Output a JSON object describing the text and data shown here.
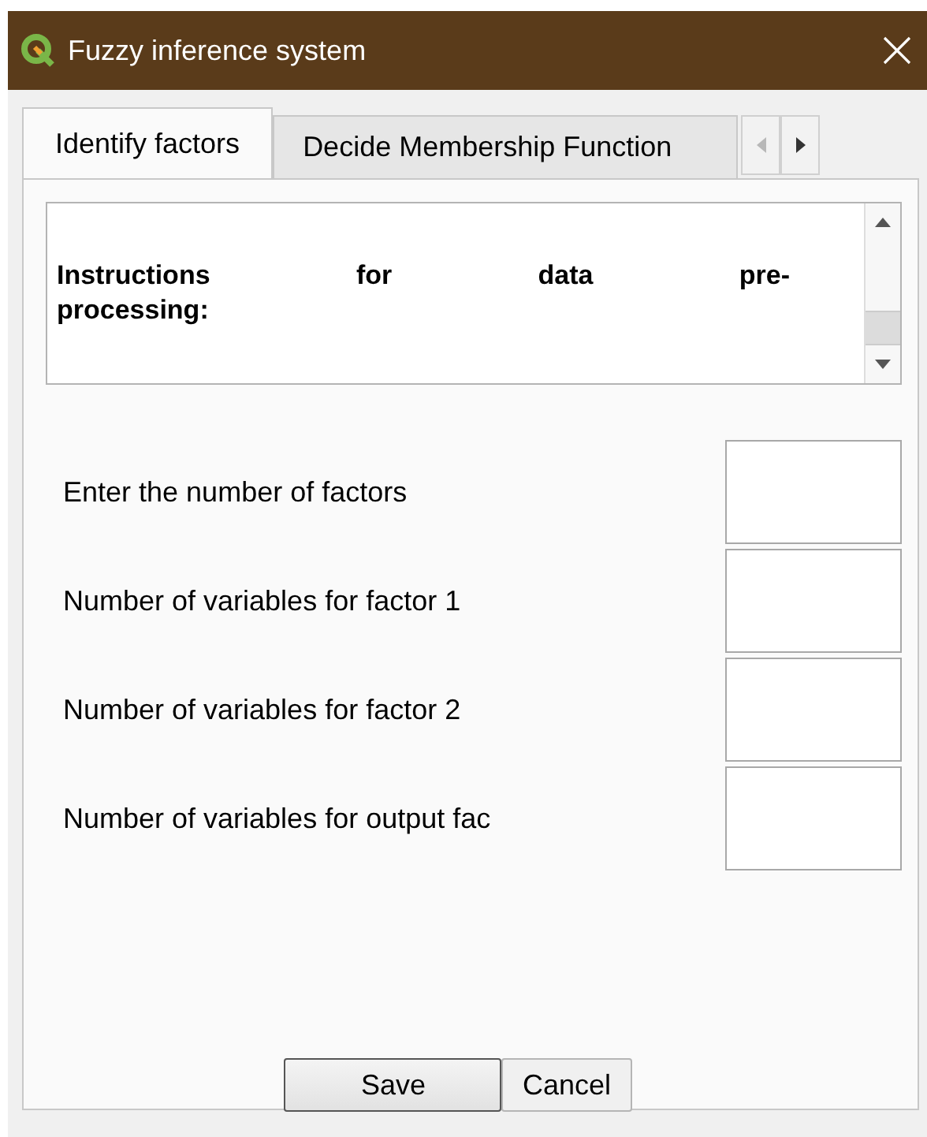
{
  "window": {
    "title": "Fuzzy inference system"
  },
  "tabs": [
    {
      "label": "Identify factors",
      "selected": true
    },
    {
      "label": "Decide Membership Function",
      "selected": false
    }
  ],
  "tab_scroll": {
    "left_disabled": true,
    "right_disabled": false
  },
  "instructions": {
    "text": "Instructions for data pre-processing:"
  },
  "fields": [
    {
      "label": "Enter the number of factors"
    },
    {
      "label": "Number of variables for factor 1"
    },
    {
      "label": "Number of variables for factor 2"
    },
    {
      "label": "Number of variables for output fac"
    }
  ],
  "buttons": [
    {
      "label": "Save",
      "default": true
    },
    {
      "label": "Cancel",
      "default": false
    }
  ]
}
